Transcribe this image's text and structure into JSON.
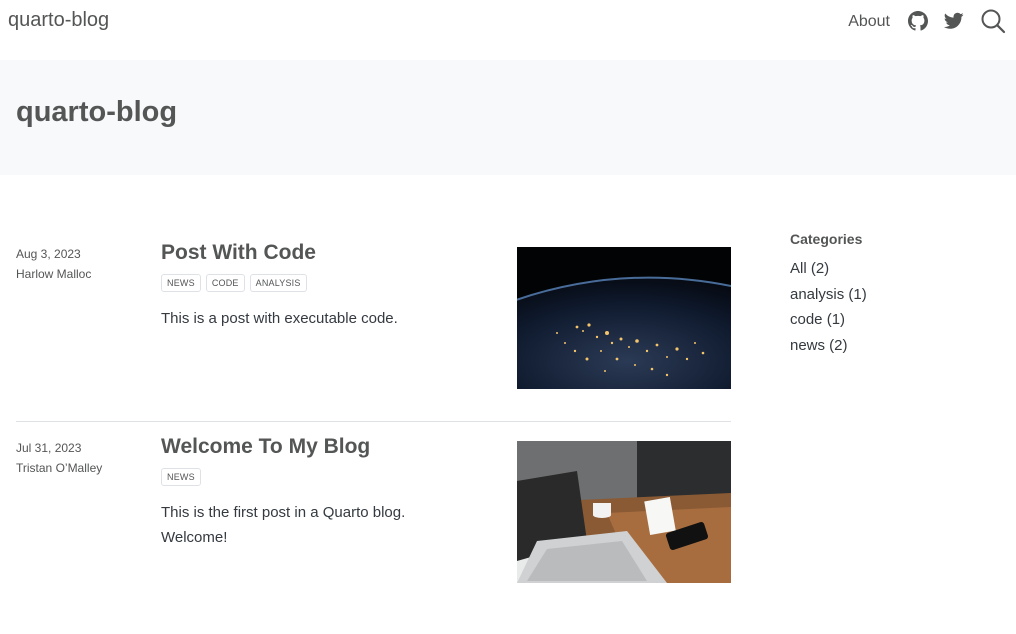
{
  "navbar": {
    "brand": "quarto-blog",
    "links": [
      {
        "label": "About"
      }
    ],
    "icons": [
      "github-icon",
      "twitter-icon",
      "search-icon"
    ]
  },
  "header": {
    "title": "quarto-blog"
  },
  "posts": [
    {
      "date": "Aug 3, 2023",
      "author": "Harlow Malloc",
      "title": "Post With Code",
      "categories": [
        "NEWS",
        "CODE",
        "ANALYSIS"
      ],
      "description": "This is a post with executable code.",
      "image": "earth-at-night-image"
    },
    {
      "date": "Jul 31, 2023",
      "author": "Tristan O’Malley",
      "title": "Welcome To My Blog",
      "categories": [
        "NEWS"
      ],
      "description": "This is the first post in a Quarto blog. Welcome!",
      "image": "laptop-desk-image"
    }
  ],
  "sidebar": {
    "title": "Categories",
    "items": [
      {
        "label": "All (2)"
      },
      {
        "label": "analysis (1)"
      },
      {
        "label": "code (1)"
      },
      {
        "label": "news (2)"
      }
    ]
  }
}
